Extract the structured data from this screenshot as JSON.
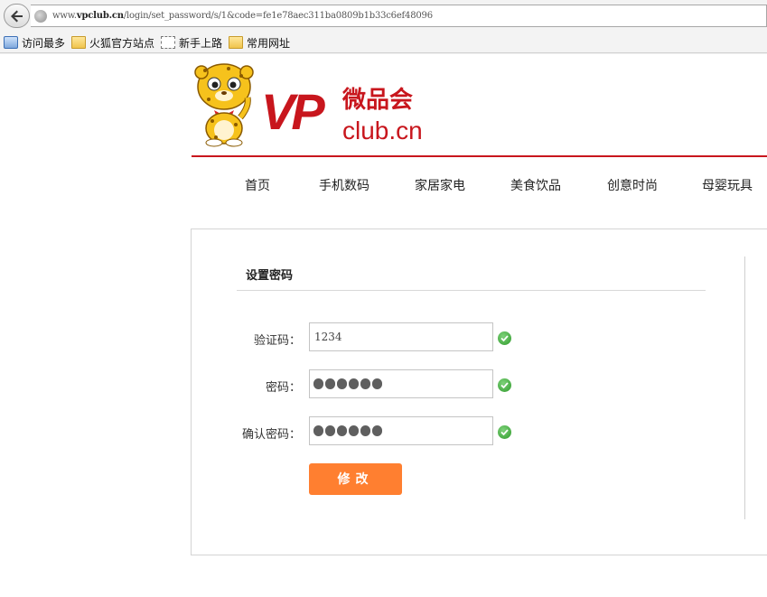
{
  "browser": {
    "url_prefix": "www.",
    "url_domain": "vpclub.cn",
    "url_path": "/login/set_password/s/1&code=fe1e78aec311ba0809b1b33c6ef48096",
    "bookmarks": [
      {
        "label": "访问最多",
        "icon": "search-icon"
      },
      {
        "label": "火狐官方站点",
        "icon": "folder-icon"
      },
      {
        "label": "新手上路",
        "icon": "page-icon"
      },
      {
        "label": "常用网址",
        "icon": "folder-icon"
      }
    ]
  },
  "logo": {
    "letters": "VP",
    "name_cn": "微品会",
    "domain": "club.cn",
    "brand_color": "#c8161d"
  },
  "menu": [
    "首页",
    "手机数码",
    "家居家电",
    "美食饮品",
    "创意时尚",
    "母婴玩具"
  ],
  "form": {
    "title": "设置密码",
    "fields": [
      {
        "label": "验证码：",
        "value": "1234",
        "type": "text"
      },
      {
        "label": "密码：",
        "value": "●●●●●●",
        "type": "password"
      },
      {
        "label": "确认密码：",
        "value": "●●●●●●",
        "type": "password"
      }
    ],
    "submit_label": "修改",
    "accent_color": "#ff7f30",
    "valid_icon": "check-icon"
  }
}
